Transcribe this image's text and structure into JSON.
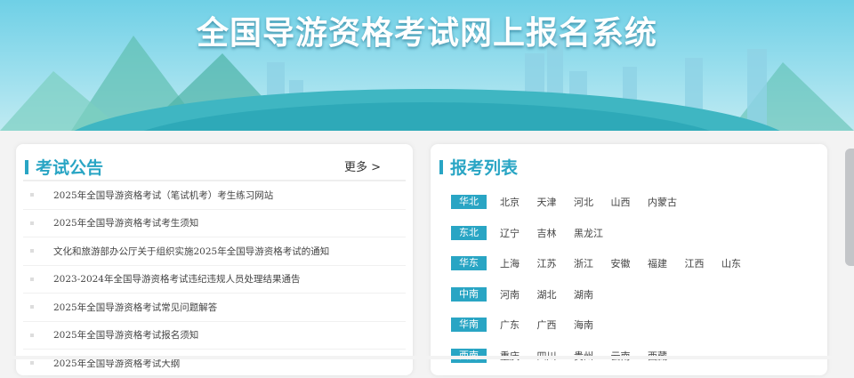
{
  "header": {
    "title": "全国导游资格考试网上报名系统"
  },
  "notices": {
    "title": "考试公告",
    "more": "更多 >",
    "items": [
      "2025年全国导游资格考试（笔试机考）考生练习网站",
      "2025年全国导游资格考试考生须知",
      "文化和旅游部办公厅关于组织实施2025年全国导游资格考试的通知",
      "2023-2024年全国导游资格考试违纪违规人员处理结果通告",
      "2025年全国导游资格考试常见问题解答",
      "2025年全国导游资格考试报名须知",
      "2025年全国导游资格考试大纲"
    ]
  },
  "regions": {
    "title": "报考列表",
    "rows": [
      {
        "name": "华北",
        "provinces": [
          "北京",
          "天津",
          "河北",
          "山西",
          "内蒙古"
        ]
      },
      {
        "name": "东北",
        "provinces": [
          "辽宁",
          "吉林",
          "黑龙江"
        ]
      },
      {
        "name": "华东",
        "provinces": [
          "上海",
          "江苏",
          "浙江",
          "安徽",
          "福建",
          "江西",
          "山东"
        ]
      },
      {
        "name": "中南",
        "provinces": [
          "河南",
          "湖北",
          "湖南"
        ]
      },
      {
        "name": "华南",
        "provinces": [
          "广东",
          "广西",
          "海南"
        ]
      },
      {
        "name": "西南",
        "provinces": [
          "重庆",
          "四川",
          "贵州",
          "云南",
          "西藏"
        ]
      }
    ]
  },
  "colors": {
    "accent": "#29a5c4"
  }
}
